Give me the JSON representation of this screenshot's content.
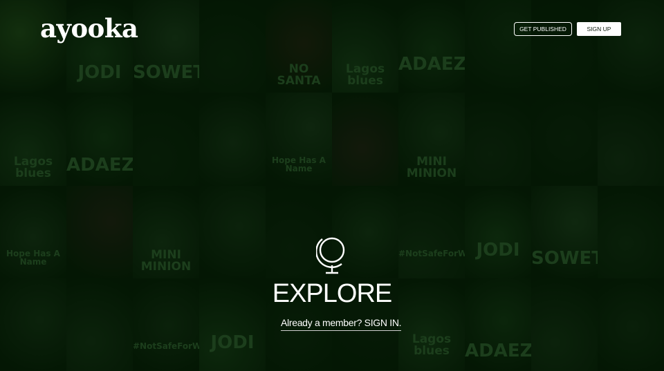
{
  "brand": {
    "logo_text": "ayooka"
  },
  "header": {
    "get_published_label": "GET PUBLISHED",
    "sign_up_label": "SIGN UP"
  },
  "hero": {
    "explore_label": "EXPLORE",
    "signin_text": "Already a member? SIGN IN."
  },
  "background_covers": [
    {
      "text": "",
      "color": "#2a4a20"
    },
    {
      "text": "JODI",
      "color": "#1d3a1d"
    },
    {
      "text": "SOWETO",
      "color": "#233a23"
    },
    {
      "text": "",
      "color": "#102010"
    },
    {
      "text": "NO SANTA",
      "color": "#2a1a15"
    },
    {
      "text": "Lagos blues",
      "color": "#1f3a1f"
    },
    {
      "text": "ADAEZE",
      "color": "#1a351a"
    },
    {
      "text": "",
      "color": "#152a15"
    },
    {
      "text": "",
      "color": "#0e1c0e"
    },
    {
      "text": "",
      "color": "#1a2e1a"
    },
    {
      "text": "Lagos blues",
      "color": "#1f3a1f"
    },
    {
      "text": "ADAEZE",
      "color": "#1a351a"
    },
    {
      "text": "",
      "color": "#0f1f0f"
    },
    {
      "text": "",
      "color": "#1c301c"
    },
    {
      "text": "Hope Has A Name",
      "color": "#203520"
    },
    {
      "text": "",
      "color": "#2a1a1a"
    },
    {
      "text": "MINI MINION",
      "color": "#1d331d"
    },
    {
      "text": "",
      "color": "#142414"
    },
    {
      "text": "",
      "color": "#101e10"
    },
    {
      "text": "",
      "color": "#1a2a1a"
    },
    {
      "text": "Hope Has A Name",
      "color": "#1e321e"
    },
    {
      "text": "",
      "color": "#2a1a1a"
    },
    {
      "text": "MINI MINION",
      "color": "#1d331d"
    },
    {
      "text": "",
      "color": "#1a2e1a"
    },
    {
      "text": "",
      "color": "#101e10"
    },
    {
      "text": "",
      "color": "#1c321c"
    },
    {
      "text": "#NotSafeForWork",
      "color": "#182b18"
    },
    {
      "text": "JODI",
      "color": "#1d3a1d"
    },
    {
      "text": "SOWETO",
      "color": "#233a23"
    },
    {
      "text": "",
      "color": "#152815"
    },
    {
      "text": "",
      "color": "#1a2e1a"
    },
    {
      "text": "",
      "color": "#1a2e1a"
    },
    {
      "text": "#NotSafeForWork",
      "color": "#182b18"
    },
    {
      "text": "JODI",
      "color": "#1d3a1d"
    },
    {
      "text": "",
      "color": "#102010"
    },
    {
      "text": "",
      "color": "#101c10"
    },
    {
      "text": "Lagos blues",
      "color": "#1f3a1f"
    },
    {
      "text": "ADAEZE",
      "color": "#1a351a"
    },
    {
      "text": "",
      "color": "#1a2e1a"
    },
    {
      "text": "",
      "color": "#152815"
    }
  ]
}
